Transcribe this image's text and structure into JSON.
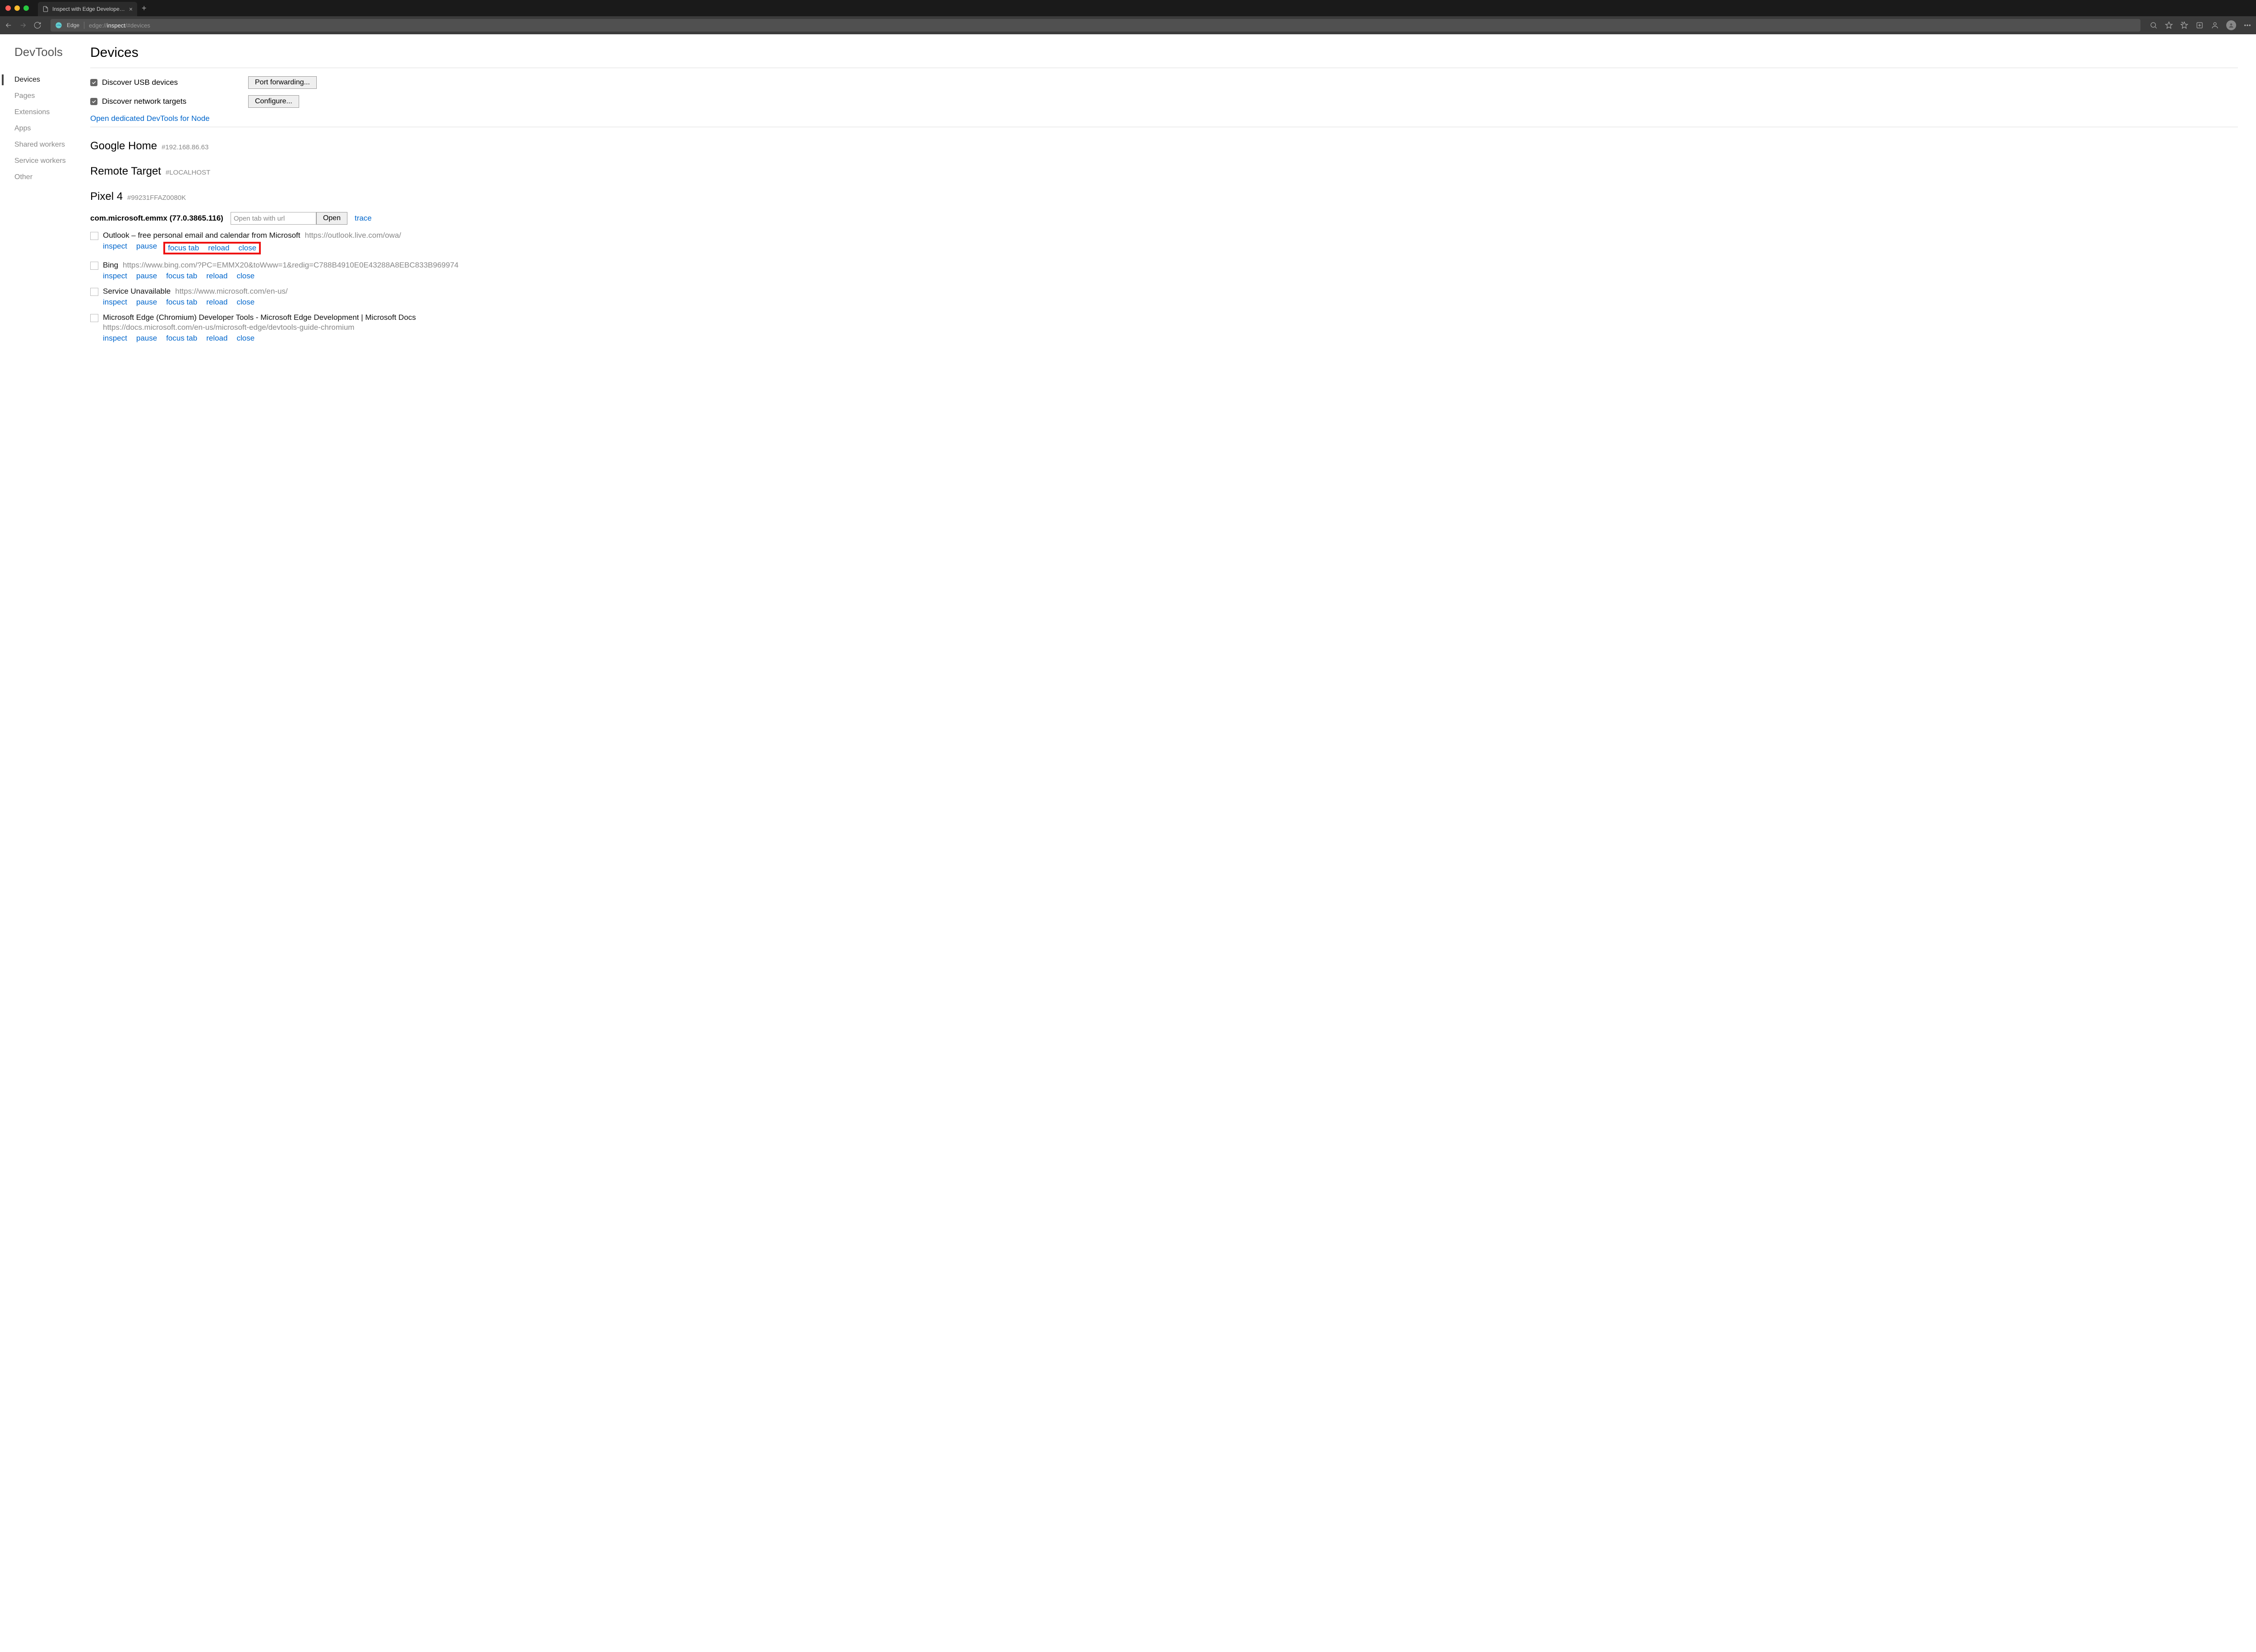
{
  "window": {
    "tab_title": "Inspect with Edge Developer T",
    "edge_label": "Edge",
    "address_pre": "edge://",
    "address_highlight": "inspect",
    "address_post": "/#devices"
  },
  "sidebar": {
    "title": "DevTools",
    "items": [
      {
        "label": "Devices",
        "active": true
      },
      {
        "label": "Pages"
      },
      {
        "label": "Extensions"
      },
      {
        "label": "Apps"
      },
      {
        "label": "Shared workers"
      },
      {
        "label": "Service workers"
      },
      {
        "label": "Other"
      }
    ]
  },
  "main": {
    "title": "Devices",
    "options": [
      {
        "label": "Discover USB devices",
        "button": "Port forwarding...",
        "checked": true
      },
      {
        "label": "Discover network targets",
        "button": "Configure...",
        "checked": true
      }
    ],
    "node_link": "Open dedicated DevTools for Node",
    "sections": [
      {
        "title": "Google Home",
        "sub": "#192.168.86.63"
      },
      {
        "title": "Remote Target",
        "sub": "#LOCALHOST"
      },
      {
        "title": "Pixel 4",
        "sub": "#99231FFAZ0080K"
      }
    ],
    "browser": {
      "name": "com.microsoft.emmx (77.0.3865.116)",
      "open_placeholder": "Open tab with url",
      "open_button": "Open",
      "trace": "trace"
    },
    "actions": {
      "inspect": "inspect",
      "pause": "pause",
      "focus_tab": "focus tab",
      "reload": "reload",
      "close": "close"
    },
    "targets": [
      {
        "name": "Outlook – free personal email and calendar from Microsoft",
        "url": "https://outlook.live.com/owa/",
        "highlighted": true
      },
      {
        "name": "Bing",
        "url": "https://www.bing.com/?PC=EMMX20&toWww=1&redig=C788B4910E0E43288A8EBC833B969974"
      },
      {
        "name": "Service Unavailable",
        "url": "https://www.microsoft.com/en-us/"
      },
      {
        "name": "Microsoft Edge (Chromium) Developer Tools - Microsoft Edge Development | Microsoft Docs",
        "url": "https://docs.microsoft.com/en-us/microsoft-edge/devtools-guide-chromium",
        "url_below": true
      }
    ]
  }
}
